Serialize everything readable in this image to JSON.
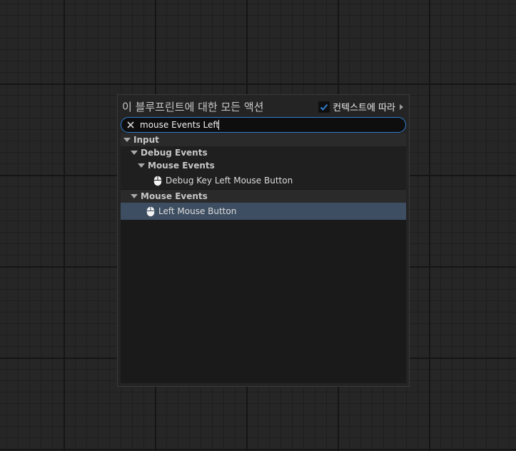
{
  "panel": {
    "title": "이 블루프린트에 대한 모든 액션",
    "context_label": "컨텍스트에 따라",
    "context_checked": true,
    "accent_color": "#2f7fd1"
  },
  "search": {
    "value": "mouse Events Left",
    "clear_icon": "x-icon"
  },
  "tree": {
    "input_category": "Input",
    "debug_events": "Debug Events",
    "debug_mouse_events": "Mouse Events",
    "debug_key_left_mouse": "Debug Key Left Mouse Button",
    "mouse_events": "Mouse Events",
    "left_mouse_button": "Left Mouse Button",
    "item_icon": "mouse-icon",
    "selected_color": "#3e4e62"
  }
}
